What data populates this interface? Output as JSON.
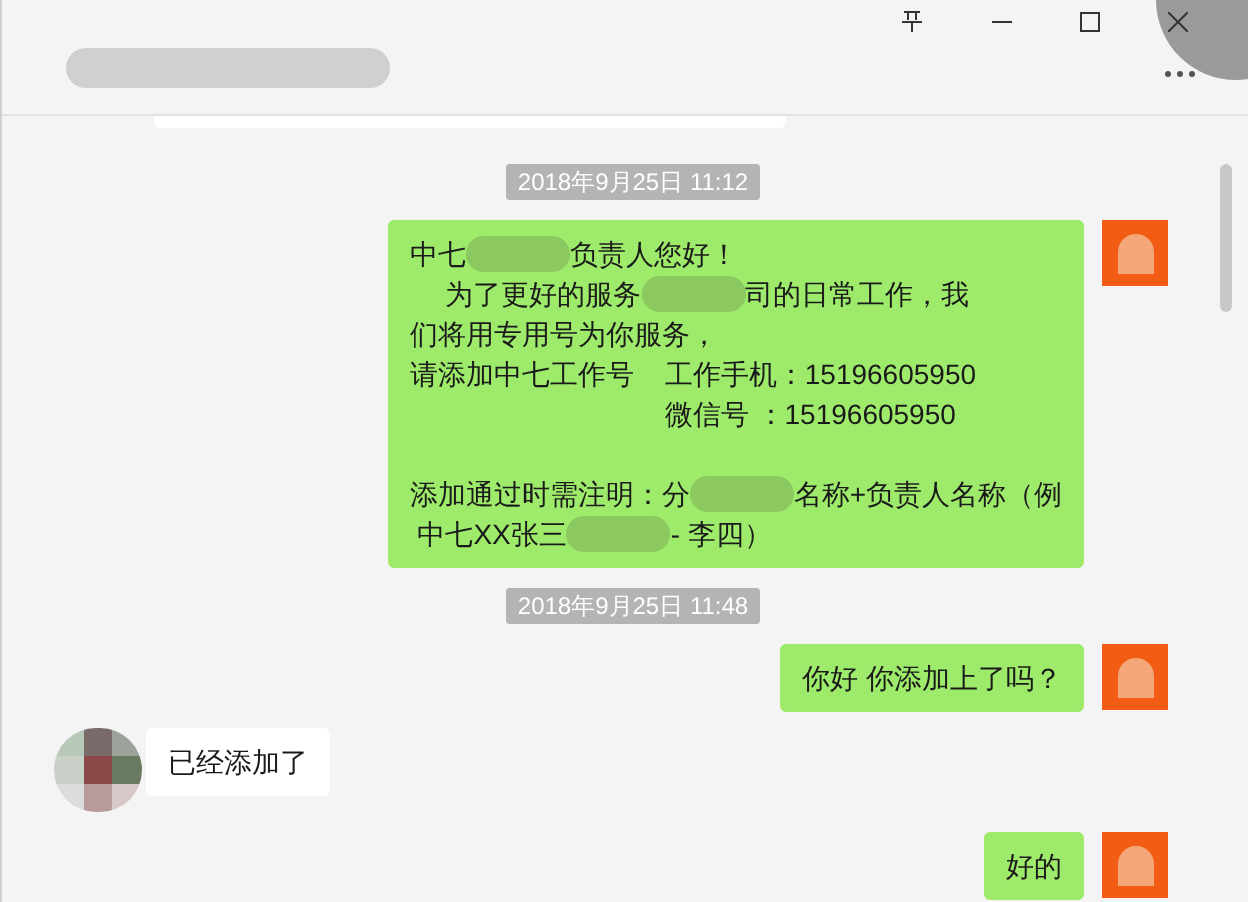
{
  "window": {
    "controls": [
      {
        "kind": "pin"
      },
      {
        "kind": "minimize"
      },
      {
        "kind": "maximize"
      },
      {
        "kind": "close"
      }
    ]
  },
  "messages": [
    {
      "kind": "timestamp",
      "text": "2018年9月25日 11:12"
    },
    {
      "kind": "outgoing",
      "paragraphs": [
        [
          [
            {
              "kind": "text",
              "text": "中七"
            },
            {
              "kind": "blur"
            },
            {
              "kind": "text",
              "text": "负责人您好！"
            }
          ],
          [
            {
              "kind": "text",
              "text": "　 为了更好的服务"
            },
            {
              "kind": "blur"
            },
            {
              "kind": "text",
              "text": "司的日常工作，我"
            }
          ],
          [
            {
              "kind": "text",
              "text": "们将用专用号为你服务，"
            }
          ],
          [
            {
              "kind": "text",
              "text": "请添加中七工作号    工作手机：15196605950"
            }
          ],
          [
            {
              "kind": "text",
              "text": "　　　　　　　　    微信号 ：15196605950"
            }
          ]
        ],
        [
          [
            {
              "kind": "text",
              "text": "添加通过时需注明：分"
            },
            {
              "kind": "blur"
            },
            {
              "kind": "text",
              "text": "名称+负责人名称（例"
            }
          ],
          [
            {
              "kind": "text",
              "text": " 中七XX张三"
            },
            {
              "kind": "blur"
            },
            {
              "kind": "text",
              "text": "- 李四）"
            }
          ]
        ]
      ]
    },
    {
      "kind": "timestamp",
      "text": "2018年9月25日 11:48"
    },
    {
      "kind": "outgoing",
      "paragraphs": [
        [
          [
            {
              "kind": "text",
              "text": "你好 你添加上了吗？"
            }
          ]
        ]
      ]
    },
    {
      "kind": "incoming",
      "paragraphs": [
        [
          [
            {
              "kind": "text",
              "text": "已经添加了"
            }
          ]
        ]
      ]
    },
    {
      "kind": "outgoing",
      "paragraphs": [
        [
          [
            {
              "kind": "text",
              "text": "好的"
            }
          ]
        ]
      ]
    }
  ]
}
